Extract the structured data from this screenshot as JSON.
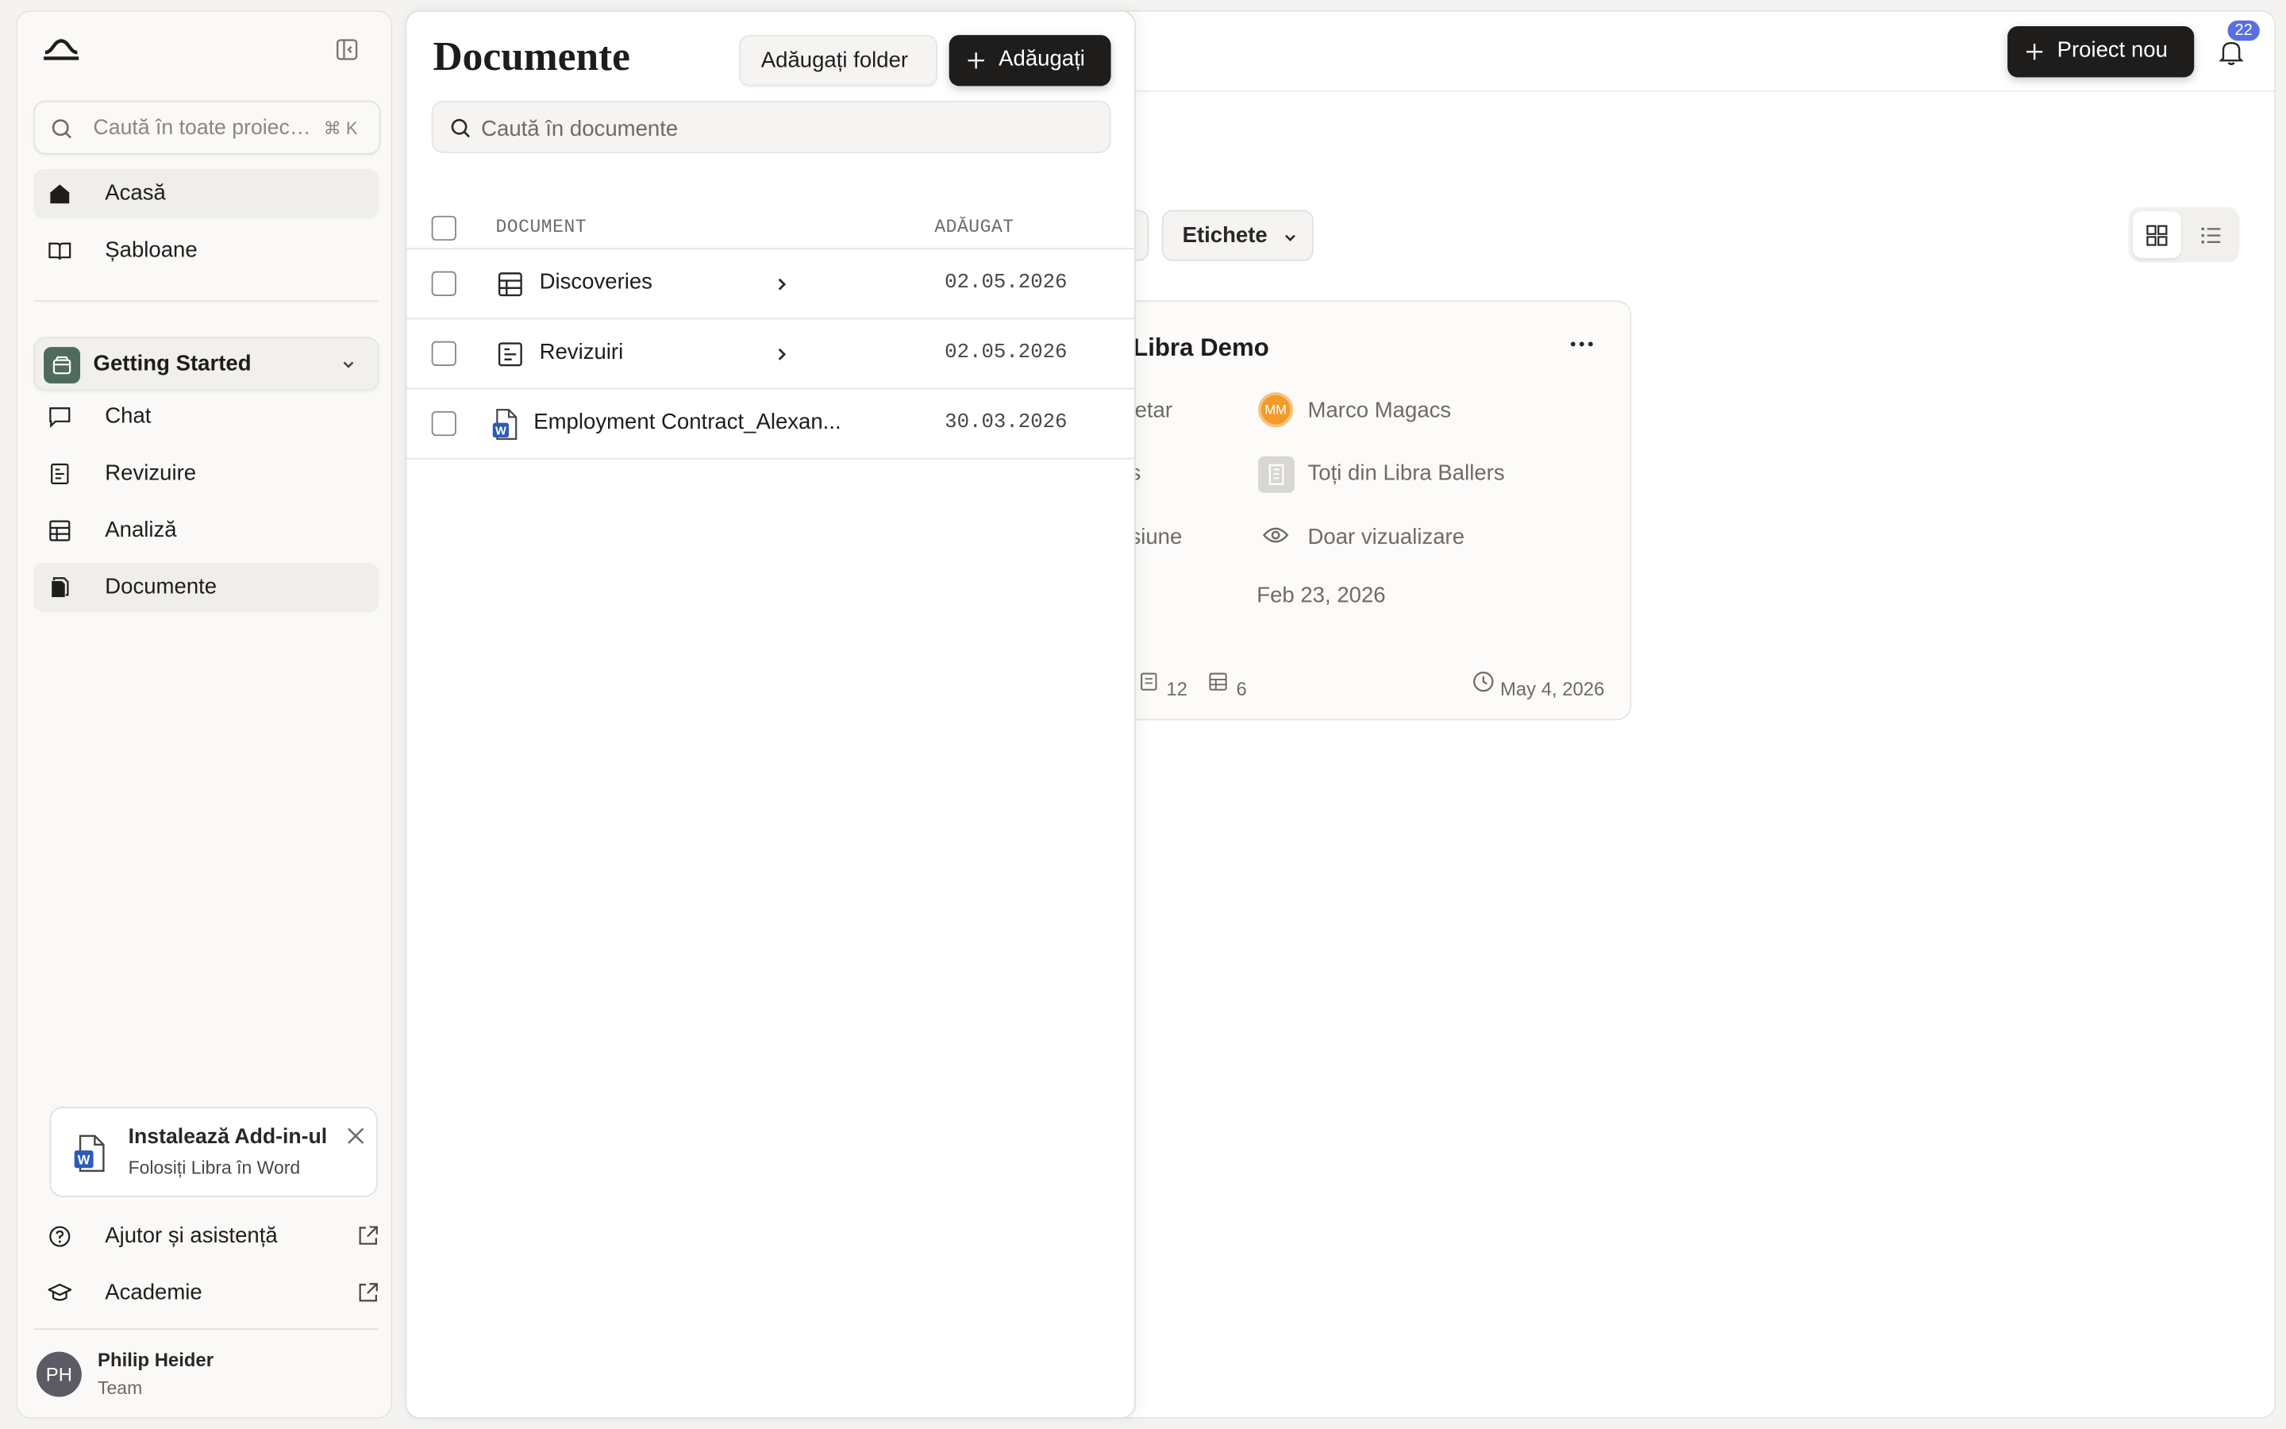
{
  "sidebar": {
    "search_placeholder": "Caută în toate proiectele",
    "search_shortcut": "⌘ K",
    "nav_top": [
      {
        "label": "Acasă",
        "icon": "home-icon"
      },
      {
        "label": "Șabloane",
        "icon": "book-icon"
      }
    ],
    "project": {
      "label": "Getting Started",
      "color": "#4e6b5b"
    },
    "nav_project": [
      {
        "label": "Chat",
        "icon": "chat-icon"
      },
      {
        "label": "Revizuire",
        "icon": "review-icon"
      },
      {
        "label": "Analiză",
        "icon": "table-icon"
      },
      {
        "label": "Documente",
        "icon": "documents-icon"
      }
    ],
    "addin": {
      "title": "Instalează Add-in-ul",
      "subtitle": "Folosiți Libra în Word"
    },
    "nav_bottom": [
      {
        "label": "Ajutor și asistență",
        "icon": "help-icon"
      },
      {
        "label": "Academie",
        "icon": "academy-icon"
      }
    ],
    "user": {
      "initials": "PH",
      "name": "Philip Heider",
      "plan": "Team"
    }
  },
  "header": {
    "new_project_label": "Proiect nou",
    "notification_count": "22"
  },
  "filters": {
    "tags_label": "Etichete"
  },
  "project_card": {
    "title": "Libra Demo",
    "owner_label": "ietar",
    "owner_initials": "MM",
    "owner_name": "Marco Magacs",
    "team_label": "s",
    "team_value": "Toți din Libra Ballers",
    "permission_label": "siune",
    "permission_value": "Doar vizualizare",
    "created": "Feb 23, 2026",
    "review_count": "12",
    "table_count": "6",
    "updated": "May 4, 2026"
  },
  "documents": {
    "title": "Documente",
    "add_folder_label": "Adăugați folder",
    "add_label": "Adăugați",
    "search_placeholder": "Caută în documente",
    "columns": {
      "document": "DOCUMENT",
      "added": "ADĂUGAT"
    },
    "rows": [
      {
        "name": "Discoveries",
        "type": "table",
        "date": "02.05.2026",
        "has_children": true
      },
      {
        "name": "Revizuiri",
        "type": "review",
        "date": "02.05.2026",
        "has_children": true
      },
      {
        "name": "Employment Contract_Alexan...",
        "type": "word",
        "date": "30.03.2026",
        "has_children": false
      }
    ]
  },
  "colors": {
    "accent_dark": "#1f1d1b",
    "badge": "#5b6ee1",
    "avatar_owner": "#f29b2a"
  }
}
